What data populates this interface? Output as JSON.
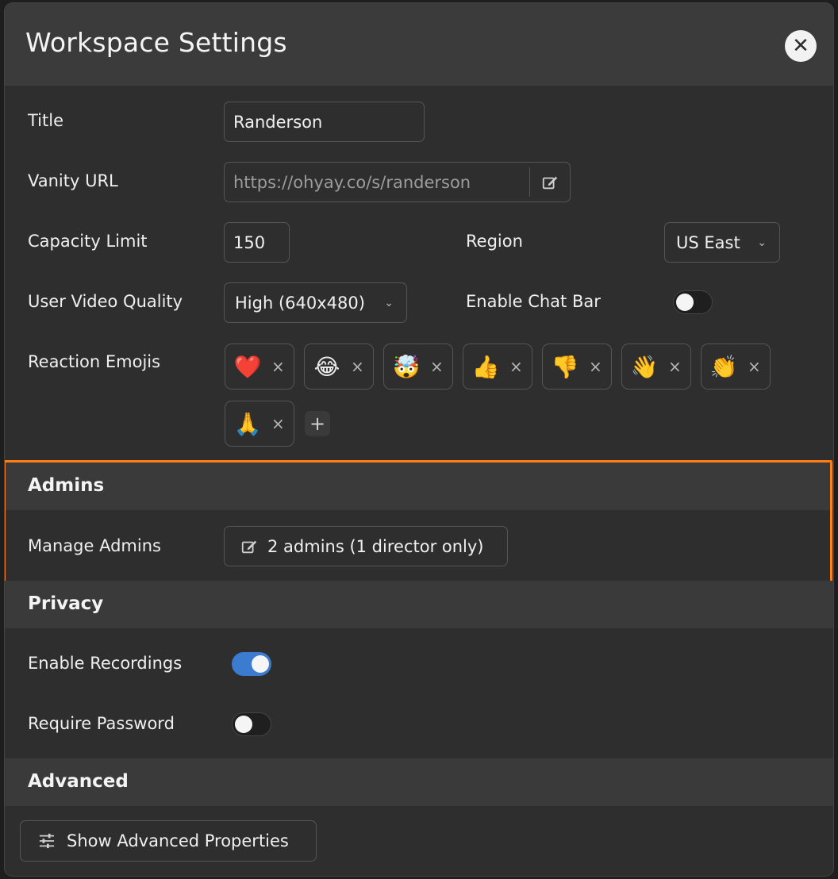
{
  "dialog": {
    "title": "Workspace Settings",
    "close_icon": "close-icon"
  },
  "general": {
    "title_label": "Title",
    "title_value": "Randerson",
    "vanity_label": "Vanity URL",
    "vanity_value": "https://ohyay.co/s/randerson",
    "capacity_label": "Capacity Limit",
    "capacity_value": "150",
    "region_label": "Region",
    "region_value": "US East",
    "video_label": "User Video Quality",
    "video_value": "High (640x480)",
    "chatbar_label": "Enable Chat Bar",
    "chatbar_enabled": false,
    "emoji_label": "Reaction Emojis",
    "emojis": [
      "❤️",
      "😂",
      "🤯",
      "👍",
      "👎",
      "👋",
      "👏",
      "🙏"
    ],
    "emoji_remove": "×",
    "emoji_add": "+"
  },
  "admins": {
    "section_title": "Admins",
    "manage_label": "Manage Admins",
    "manage_button": "2 admins (1 director only)",
    "highlight_color": "#ff7e16"
  },
  "privacy": {
    "section_title": "Privacy",
    "recordings_label": "Enable Recordings",
    "recordings_enabled": true,
    "password_label": "Require Password",
    "password_enabled": false
  },
  "advanced": {
    "section_title": "Advanced",
    "show_button": "Show Advanced Properties"
  },
  "colors": {
    "accent": "#3b7bd0",
    "highlight": "#ff7e16"
  }
}
